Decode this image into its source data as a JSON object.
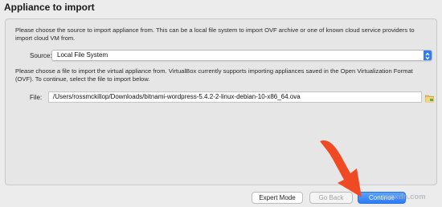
{
  "dialog": {
    "title": "Appliance to import"
  },
  "source_section": {
    "description": "Please choose the source to import appliance from. This can be a local file system to import OVF archive or one of known cloud service providers to import cloud VM from.",
    "label": "Source:",
    "selected_value": "Local File System"
  },
  "file_section": {
    "description": "Please choose a file to import the virtual appliance from. VirtualBox currently supports importing appliances saved in the Open Virtualization Format (OVF). To continue, select the file to import below.",
    "label": "File:",
    "value": "/Users/rossmckillop/Downloads/bitnami-wordpress-5.4.2-2-linux-debian-10-x86_64.ova",
    "browse_icon": "folder-icon"
  },
  "buttons": {
    "expert_mode": "Expert Mode",
    "go_back": "Go Back",
    "continue": "Continue"
  },
  "overlay": {
    "watermark": "wsxdn.com",
    "arrow_color": "#f04a24"
  },
  "colors": {
    "accent": "#2f7df6",
    "background": "#ececec"
  }
}
